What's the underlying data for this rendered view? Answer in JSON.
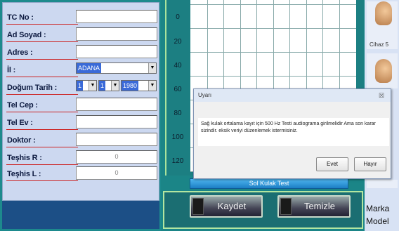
{
  "form": {
    "tc_no": {
      "label": "TC No :",
      "value": ""
    },
    "ad_soyad": {
      "label": "Ad Soyad :",
      "value": ""
    },
    "adres": {
      "label": "Adres :",
      "value": ""
    },
    "il": {
      "label": "İl :",
      "selected": "ADANA"
    },
    "dogum_tarihi": {
      "label": "Doğum Tarih :",
      "day": "1",
      "month": "1",
      "year": "1980"
    },
    "tel_cep": {
      "label": "Tel Cep :",
      "value": ""
    },
    "tel_ev": {
      "label": "Tel Ev :",
      "value": ""
    },
    "doktor": {
      "label": "Doktor :",
      "value": ""
    },
    "teshis_r": {
      "label": "Teşhis R :",
      "value": "0"
    },
    "teshis_l": {
      "label": "Teşhis L :",
      "value": "0"
    }
  },
  "audiogram": {
    "y_ticks": [
      "0",
      "20",
      "40",
      "60",
      "80",
      "100",
      "120"
    ],
    "sol_kulak_button": "Sol Kulak Test"
  },
  "buttons": {
    "kaydet": "Kaydet",
    "temizle": "Temizle"
  },
  "right_panel": {
    "device_label": "Cihaz 5",
    "marka": "Marka",
    "model": "Model"
  },
  "dialog": {
    "title": "Uyarı",
    "close": "☒",
    "message": "Sağ kulak ortalama kayıt için 500 Hz Testi audiograma girilmelidir  Ama son karar sizindir. eksik veriyi düzenlemek istermisiniz.",
    "yes_button": "Evet",
    "no_button": "Hayır"
  },
  "colors": {
    "accent_line": "#c22222",
    "panel_bg": "#ccd8f0",
    "teal_bg": "#1b8587"
  }
}
